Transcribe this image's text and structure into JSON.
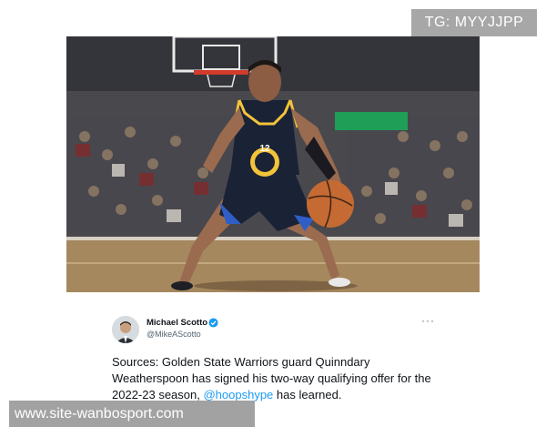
{
  "watermarks": {
    "top_right": "TG: MYYJJPP",
    "bottom_left": "www.site-wanbosport.com"
  },
  "photo": {
    "jersey_number": "12"
  },
  "tweet": {
    "author_name": "Michael Scotto",
    "author_handle": "@MikeAScotto",
    "more_icon": "···",
    "body_text": "Sources: Golden State Warriors guard Quinndary Weatherspoon has signed his two-way qualifying offer for the 2022-23 season, ",
    "mention": "@hoopshype",
    "body_tail": " has learned."
  },
  "colors": {
    "mention_blue": "#1d9bf0",
    "verified_blue": "#1d9bf0",
    "jersey_navy": "#1a2236",
    "jersey_gold": "#f3c33a"
  }
}
